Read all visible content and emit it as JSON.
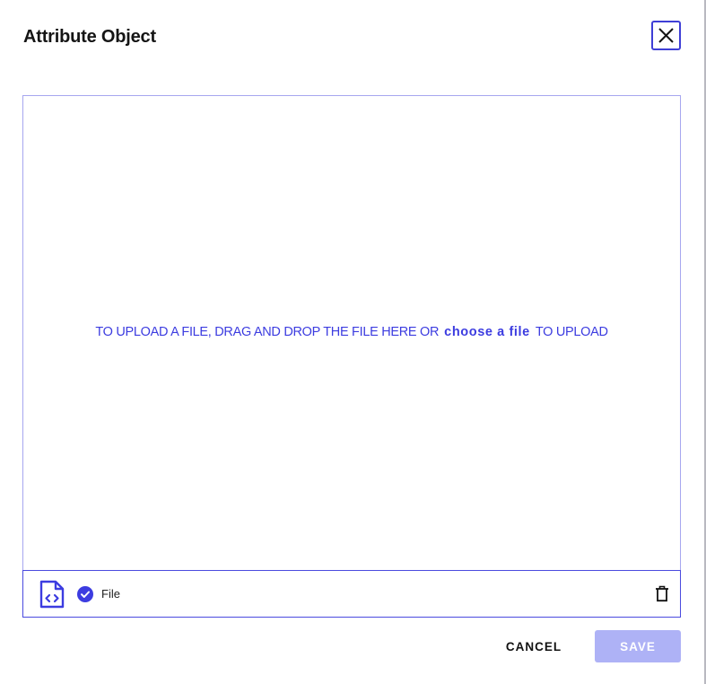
{
  "dialog": {
    "title": "Attribute Object",
    "close_icon": "close-icon"
  },
  "dropzone": {
    "text_before": "TO UPLOAD A FILE, DRAG AND DROP THE FILE HERE OR",
    "link_label": "choose a file",
    "text_after": "TO UPLOAD"
  },
  "file": {
    "icon": "code-file-icon",
    "status_icon": "check-circle-icon",
    "name": "File",
    "delete_icon": "trash-icon"
  },
  "footer": {
    "cancel_label": "CANCEL",
    "save_label": "SAVE"
  },
  "colors": {
    "accent": "#3c3ce0",
    "save_disabled": "#aeb2f6",
    "dropzone_border": "#a6a6ef"
  }
}
